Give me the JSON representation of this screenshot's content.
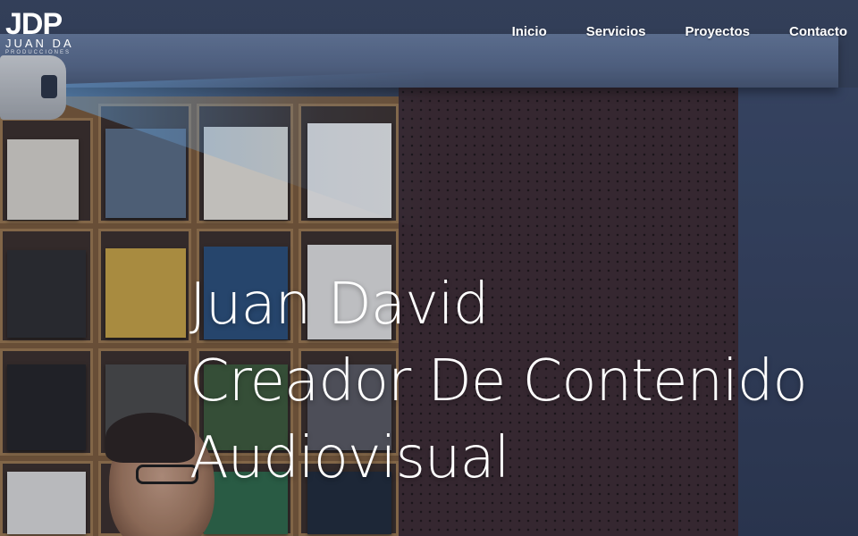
{
  "brand": {
    "mark": "JDP",
    "name": "JUAN DA",
    "sub": "PRODUCCIONES"
  },
  "nav": {
    "items": [
      {
        "label": "Inicio"
      },
      {
        "label": "Servicios"
      },
      {
        "label": "Proyectos"
      },
      {
        "label": "Contacto"
      }
    ]
  },
  "hero": {
    "line1": "Juan David",
    "line2": "Creador De Contenido",
    "line3": "Audiovisual"
  },
  "colors": {
    "text": "#ffffff",
    "wall": "#354259",
    "pegboard": "#3c2a31"
  }
}
